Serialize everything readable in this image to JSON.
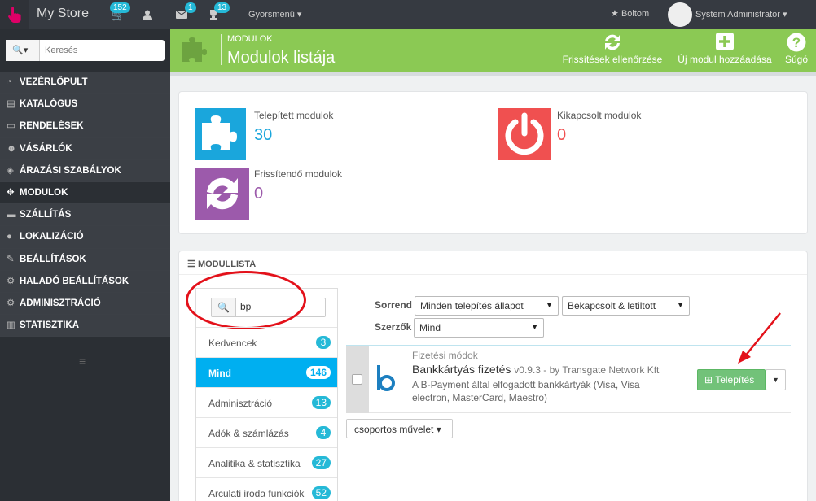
{
  "topbar": {
    "store_name": "My Store",
    "badges": {
      "orders": "152",
      "messages": "1",
      "trophies": "13"
    },
    "quickmenu": "Gyorsmenü",
    "shop": "Boltom",
    "user": "System Administrator"
  },
  "sidebar": {
    "search_placeholder": "Keresés",
    "items": [
      {
        "label": "Vezérlőpult",
        "icon": "dashboard-icon"
      },
      {
        "label": "Katalógus",
        "icon": "book-icon"
      },
      {
        "label": "Rendelések",
        "icon": "credit-card-icon"
      },
      {
        "label": "Vásárlók",
        "icon": "users-icon"
      },
      {
        "label": "Árazási szabályok",
        "icon": "tags-icon"
      },
      {
        "label": "Modulok",
        "icon": "puzzle-icon"
      },
      {
        "label": "Szállítás",
        "icon": "truck-icon"
      },
      {
        "label": "Lokalizáció",
        "icon": "globe-icon"
      },
      {
        "label": "Beállítások",
        "icon": "wrench-icon"
      },
      {
        "label": "Haladó beállítások",
        "icon": "cogs-icon"
      },
      {
        "label": "Adminisztráció",
        "icon": "cog-icon"
      },
      {
        "label": "Statisztika",
        "icon": "bar-chart-icon"
      }
    ]
  },
  "header": {
    "breadcrumb": "MODULOK",
    "title": "Modulok listája",
    "buttons": {
      "check_updates": "Frissítések ellenőrzése",
      "add_module": "Új modul hozzáadása",
      "help": "Súgó"
    }
  },
  "kpis": {
    "installed": {
      "label": "Telepített modulok",
      "value": "30"
    },
    "disabled": {
      "label": "Kikapcsolt modulok",
      "value": "0"
    },
    "to_update": {
      "label": "Frissítendő modulok",
      "value": "0"
    }
  },
  "module_list": {
    "heading": "MODULLISTA",
    "search_value": "bp",
    "categories": [
      {
        "label": "Kedvencek",
        "count": "3"
      },
      {
        "label": "Mind",
        "count": "146"
      },
      {
        "label": "Adminisztráció",
        "count": "13"
      },
      {
        "label": "Adók & számlázás",
        "count": "4"
      },
      {
        "label": "Analitika & statisztika",
        "count": "27"
      },
      {
        "label": "Arculati iroda funkciók",
        "count": "52"
      }
    ],
    "filters": {
      "sort_label": "Sorrend",
      "sort_value": "Minden telepítés állapot",
      "status_value": "Bekapcsolt & letiltott",
      "authors_label": "Szerzők",
      "authors_value": "Mind"
    },
    "module": {
      "category": "Fizetési módok",
      "name": "Bankkártyás fizetés",
      "meta": "v0.9.3 - by Transgate Network Kft",
      "description": "A B-Payment által elfogadott bankkártyák (Visa, Visa electron, MasterCard, Maestro)",
      "install_label": "Telepítés"
    },
    "bulk_action": "csoportos művelet"
  },
  "colors": {
    "header_green": "#8bc954",
    "installed_blue": "#1aa6dc",
    "disabled_red": "#f05050",
    "update_purple": "#9c5aab",
    "accent": "#25b9d7"
  }
}
